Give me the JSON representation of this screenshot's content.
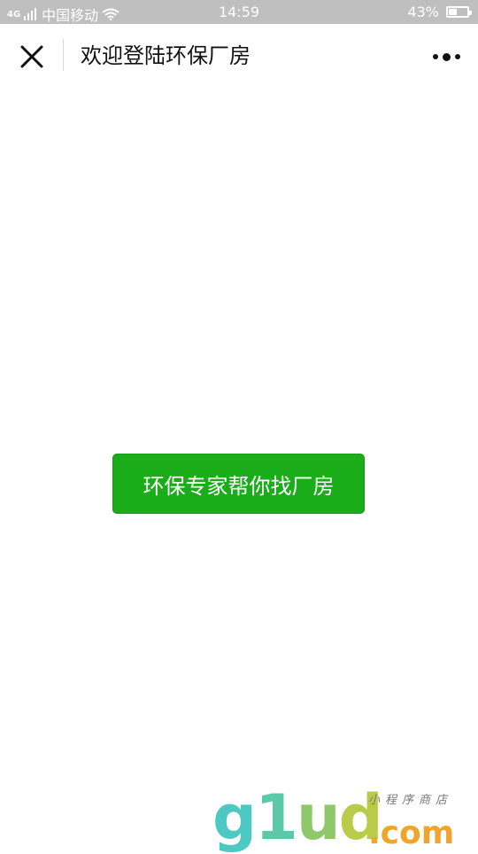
{
  "status_bar": {
    "signal_label": "4G",
    "carrier": "中国移动",
    "time": "14:59",
    "battery": "43%",
    "battery_level": 0.43,
    "background_color": "#bfbfbf"
  },
  "nav_bar": {
    "close_icon": "close-icon",
    "title": "欢迎登陆环保厂房",
    "more_icon": "more-dots-icon"
  },
  "main": {
    "cta_label": "环保专家帮你找厂房",
    "cta_color": "#1aad19"
  },
  "watermark": {
    "logo_g": "g",
    "logo_1": "1",
    "logo_u": "u",
    "logo_d": "d",
    "domain_suffix": ".com",
    "slogan": "小程序商店"
  }
}
